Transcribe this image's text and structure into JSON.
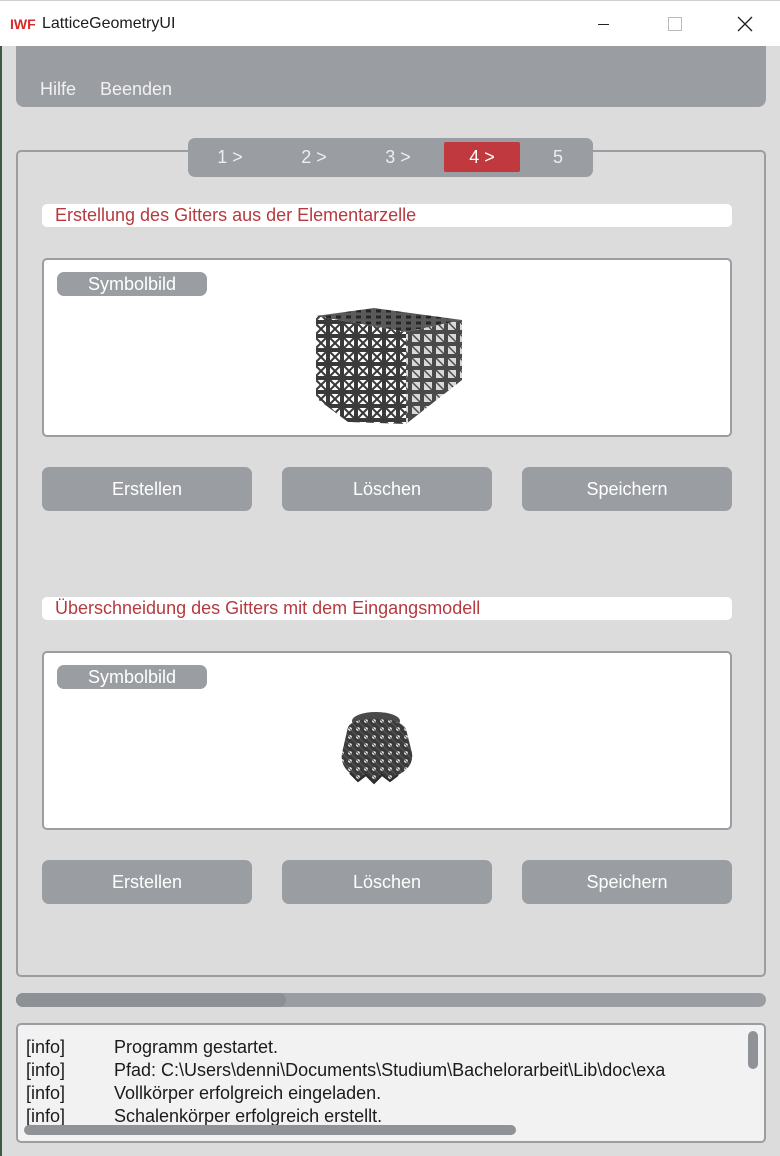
{
  "window": {
    "title": "LatticeGeometryUI",
    "logo_text": "IWF"
  },
  "menu": {
    "items": [
      "Hilfe",
      "Beenden"
    ]
  },
  "stepper": {
    "steps": [
      "1 >",
      "2 >",
      "3 >",
      "4 >",
      "5"
    ],
    "active_index": 3,
    "active_color": "#c0393f"
  },
  "sections": [
    {
      "title": "Erstellung des Gitters aus der Elementarzelle",
      "image_label": "Symbolbild",
      "buttons": [
        "Erstellen",
        "Löschen",
        "Speichern"
      ]
    },
    {
      "title": "Überschneidung des Gitters mit dem Eingangsmodell",
      "image_label": "Symbolbild",
      "buttons": [
        "Erstellen",
        "Löschen",
        "Speichern"
      ]
    }
  ],
  "progress": {
    "value_percent": 36
  },
  "log": {
    "entries": [
      {
        "level": "[info]",
        "message": "Programm gestartet."
      },
      {
        "level": "[info]",
        "message": "Pfad: C:\\Users\\denni\\Documents\\Studium\\Bachelorarbeit\\Lib\\doc\\exa"
      },
      {
        "level": "[info]",
        "message": "Vollkörper erfolgreich eingeladen."
      },
      {
        "level": "[info]",
        "message": "Schalenkörper erfolgreich erstellt."
      }
    ]
  },
  "colors": {
    "accent": "#c0393f",
    "panel_gray": "#9a9da2",
    "background": "#dcdcdc"
  }
}
